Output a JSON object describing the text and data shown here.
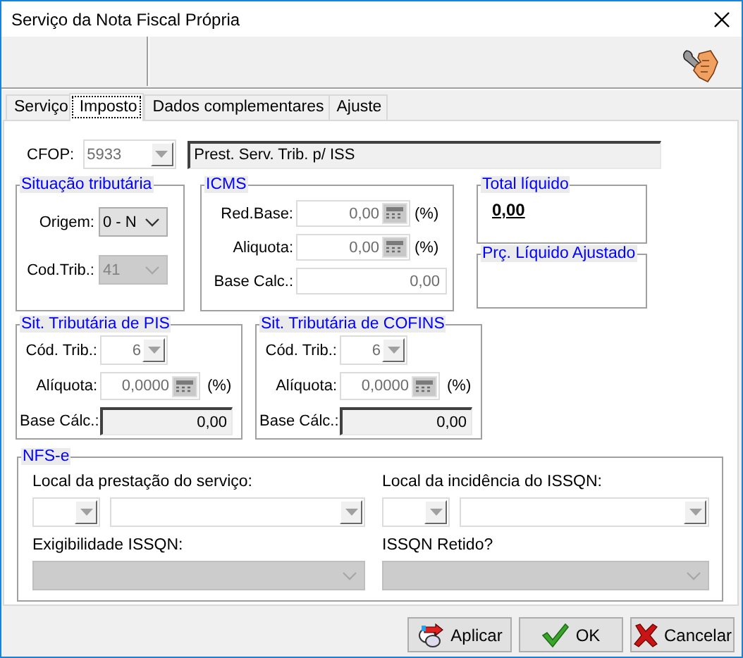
{
  "window": {
    "title": "Serviço da Nota Fiscal Própria"
  },
  "tabs": [
    {
      "label": "Serviço",
      "selected": false
    },
    {
      "label": "Imposto",
      "selected": true
    },
    {
      "label": "Dados complementares",
      "selected": false
    },
    {
      "label": "Ajuste",
      "selected": false
    }
  ],
  "cfop": {
    "label": "CFOP:",
    "value": "5933",
    "disabled": true,
    "description": "Prest. Serv. Trib. p/ ISS"
  },
  "situacao_tributaria": {
    "title": "Situação tributária",
    "origem": {
      "label": "Origem:",
      "value": "0 - N",
      "disabled": false
    },
    "cod_trib": {
      "label": "Cod.Trib.:",
      "value": "41",
      "disabled": true
    }
  },
  "icms": {
    "title": "ICMS",
    "fields": [
      {
        "label": "Red.Base:",
        "value": "0,00",
        "kind": "calc",
        "unit": "(%)"
      },
      {
        "label": "Aliquota:",
        "value": "0,00",
        "kind": "calc",
        "unit": "(%)"
      },
      {
        "label": "Base Calc.:",
        "value": "0,00",
        "kind": "plain"
      }
    ]
  },
  "total_liquido": {
    "title": "Total líquido",
    "value": "0,00"
  },
  "preco_liquido_ajustado": {
    "title": "Prç. Líquido Ajustado"
  },
  "pis": {
    "title": "Sit. Tributária de PIS",
    "cod_trib": {
      "label": "Cód. Trib.:",
      "value": "6",
      "disabled": true
    },
    "aliquota": {
      "label": "Alíquota:",
      "value": "0,0000",
      "unit": "(%)"
    },
    "base_calc": {
      "label": "Base Cálc.:",
      "value": "0,00"
    }
  },
  "cofins": {
    "title": "Sit. Tributária de COFINS",
    "cod_trib": {
      "label": "Cód. Trib.:",
      "value": "6",
      "disabled": true
    },
    "aliquota": {
      "label": "Alíquota:",
      "value": "0,0000",
      "unit": "(%)"
    },
    "base_calc": {
      "label": "Base Cálc.:",
      "value": "0,00"
    }
  },
  "nfse": {
    "title": "NFS-e",
    "local_prestacao": {
      "label": "Local da prestação do serviço:"
    },
    "local_incidencia": {
      "label": "Local da incidência do ISSQN:"
    },
    "exigibilidade": {
      "label": "Exigibilidade ISSQN:",
      "disabled": true
    },
    "issqn_retido": {
      "label": "ISSQN Retido?",
      "disabled": true
    }
  },
  "buttons": [
    {
      "label": "Aplicar",
      "kind": "apply"
    },
    {
      "label": "OK",
      "kind": "ok"
    },
    {
      "label": "Cancelar",
      "kind": "cancel"
    }
  ]
}
